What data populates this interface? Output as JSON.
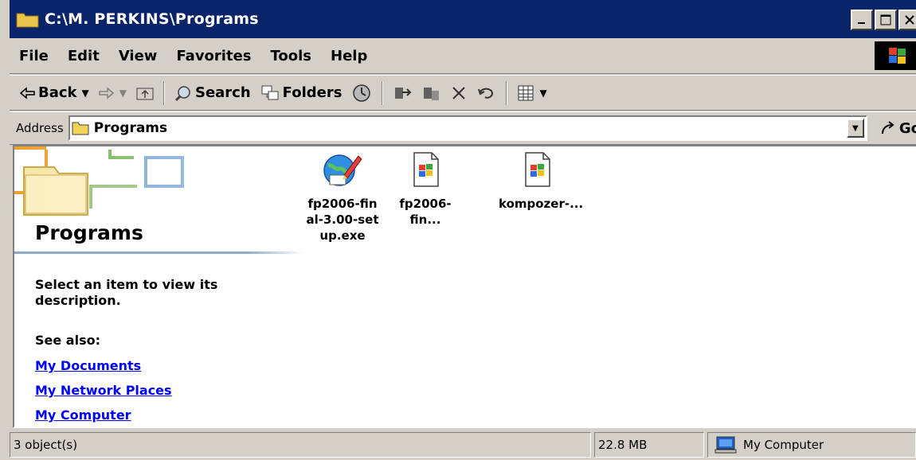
{
  "window": {
    "title": "C:\\M. PERKINS\\Programs"
  },
  "menu": {
    "items": [
      "File",
      "Edit",
      "View",
      "Favorites",
      "Tools",
      "Help"
    ]
  },
  "toolbar": {
    "back_label": "Back",
    "search_label": "Search",
    "folders_label": "Folders"
  },
  "address": {
    "label": "Address",
    "value": "Programs",
    "go_label": "Go"
  },
  "left_panel": {
    "title": "Programs",
    "description": "Select an item to view its description.",
    "see_also": "See also:",
    "links": [
      "My Documents",
      "My Network Places",
      "My Computer"
    ]
  },
  "files": [
    {
      "name": "fp2006-final-3.00-setup.exe",
      "icon": "installer-icon"
    },
    {
      "name": "fp2006-fin...",
      "icon": "windows-document-icon"
    },
    {
      "name": "kompozer-...",
      "icon": "windows-document-icon"
    }
  ],
  "status": {
    "objects": "3 object(s)",
    "size": "22.8 MB",
    "zone": "My Computer"
  },
  "colors": {
    "titlebar": "#0a246a",
    "chrome": "#d4d0c8",
    "link": "#0000ff"
  }
}
